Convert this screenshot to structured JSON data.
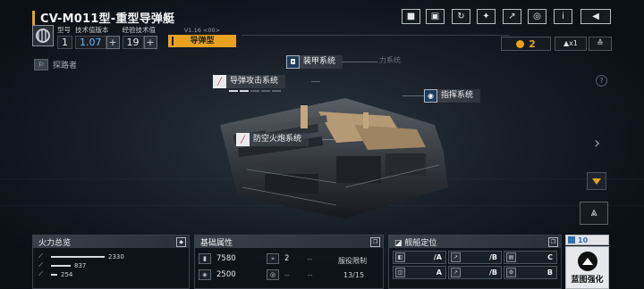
{
  "header": {
    "title": "CV-M011型-重型导弹艇",
    "spec_labels": {
      "model": "型号",
      "tech_version": "技术值版本",
      "exp_tech": "经验技术值"
    },
    "spec_values": {
      "model": "1",
      "tech_version": "1.07",
      "exp_tech": "19"
    },
    "plus_label": "+",
    "version_text": "V1.16 <00>",
    "type_tag": "导弹型"
  },
  "toolbar": {
    "buttons": [
      {
        "name": "video-icon",
        "glyph": "■"
      },
      {
        "name": "screenshot-icon",
        "glyph": "▣"
      },
      {
        "name": "refresh-icon",
        "glyph": "↻"
      },
      {
        "name": "robot-arm-icon",
        "glyph": "✦"
      },
      {
        "name": "external-link-icon",
        "glyph": "↗"
      },
      {
        "name": "target-icon",
        "glyph": "◎"
      },
      {
        "name": "info-icon",
        "glyph": "i"
      },
      {
        "name": "back-icon",
        "glyph": "◀"
      }
    ]
  },
  "resources": {
    "coin_value": "2",
    "rank_text": "▲x1",
    "lift_glyph": "≙"
  },
  "explorer": {
    "label": "探路者",
    "icon_glyph": "⚐"
  },
  "callouts": {
    "armor": "装甲系统",
    "armor_ghost": "力系统",
    "missile": "导弹攻击系统",
    "command": "指挥系统",
    "aa": "防空火炮系统"
  },
  "side": {
    "help_glyph": "?",
    "next_glyph": "›",
    "upgrade_glyph": "⩓"
  },
  "firepower": {
    "title": "火力总览",
    "rows": [
      {
        "value": "2330",
        "fraction": 1.0
      },
      {
        "value": "837",
        "fraction": 0.36
      },
      {
        "value": "254",
        "fraction": 0.11
      }
    ]
  },
  "attributes": {
    "title": "基础属性",
    "hp": "7580",
    "armor": "2500",
    "speed": "2",
    "dash1": "--",
    "dash2": "--",
    "dash3": "--",
    "service_limit_label": "服役限制",
    "service_limit_value": "13/15"
  },
  "positioning": {
    "title": "舰船定位",
    "slots": [
      "/A",
      "/B",
      "C",
      "A",
      "/B",
      "B"
    ]
  },
  "blueprint": {
    "count": "10",
    "label": "蓝图强化"
  },
  "colors": {
    "accent": "#e8a220",
    "blue": "#6fb6ff",
    "bg": "#0b1016"
  }
}
